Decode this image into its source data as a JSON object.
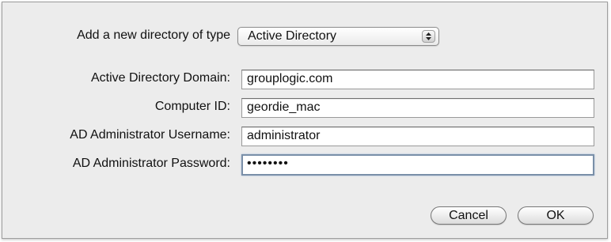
{
  "dialog": {
    "directory_type_label": "Add a new directory of type",
    "directory_type_value": "Active Directory",
    "fields": [
      {
        "label": "Active Directory Domain:",
        "value": "grouplogic.com"
      },
      {
        "label": "Computer ID:",
        "value": "geordie_mac"
      },
      {
        "label": "AD Administrator Username:",
        "value": "administrator"
      },
      {
        "label": "AD Administrator Password:",
        "value": "••••••••"
      }
    ],
    "cancel_label": "Cancel",
    "ok_label": "OK"
  }
}
